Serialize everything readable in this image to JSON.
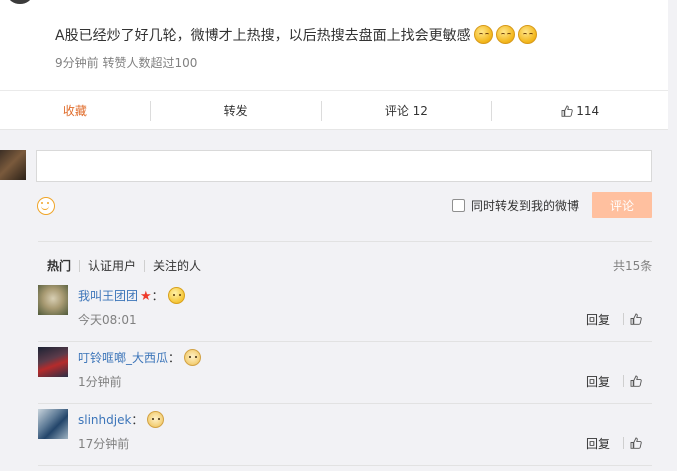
{
  "post": {
    "text": "A股已经炒了好几轮，微博才上热搜，以后热搜去盘面上找会更敏感",
    "time": "9分钟前",
    "reposts_note": "转赞人数超过100",
    "emoji_icon": "smile-emoji-icon"
  },
  "actions": {
    "favorite": "收藏",
    "repost": "转发",
    "comment": "评论 12",
    "like_count": "114"
  },
  "composer": {
    "placeholder": "",
    "repost_option": "同时转发到我的微博",
    "submit_label": "评论"
  },
  "comments_header": {
    "tabs": [
      "热门",
      "认证用户",
      "关注的人"
    ],
    "total": "共15条"
  },
  "comments": [
    {
      "name": "我叫王团团",
      "colon": "：",
      "time": "今天08:01",
      "reply": "回复",
      "has_star": true,
      "emoji": "thinking-emoji-icon"
    },
    {
      "name": "叮铃哐啷_大西瓜",
      "colon": "：",
      "time": "1分钟前",
      "reply": "回复",
      "has_star": false,
      "emoji": "doge-emoji-icon"
    },
    {
      "name": "slinhdjek",
      "colon": "：",
      "time": "17分钟前",
      "reply": "回复",
      "has_star": false,
      "emoji": "doge-emoji-icon"
    }
  ],
  "colors": {
    "accent": "#e06d2c",
    "link": "#3c75b9",
    "submit_disabled": "#ffc09f"
  }
}
